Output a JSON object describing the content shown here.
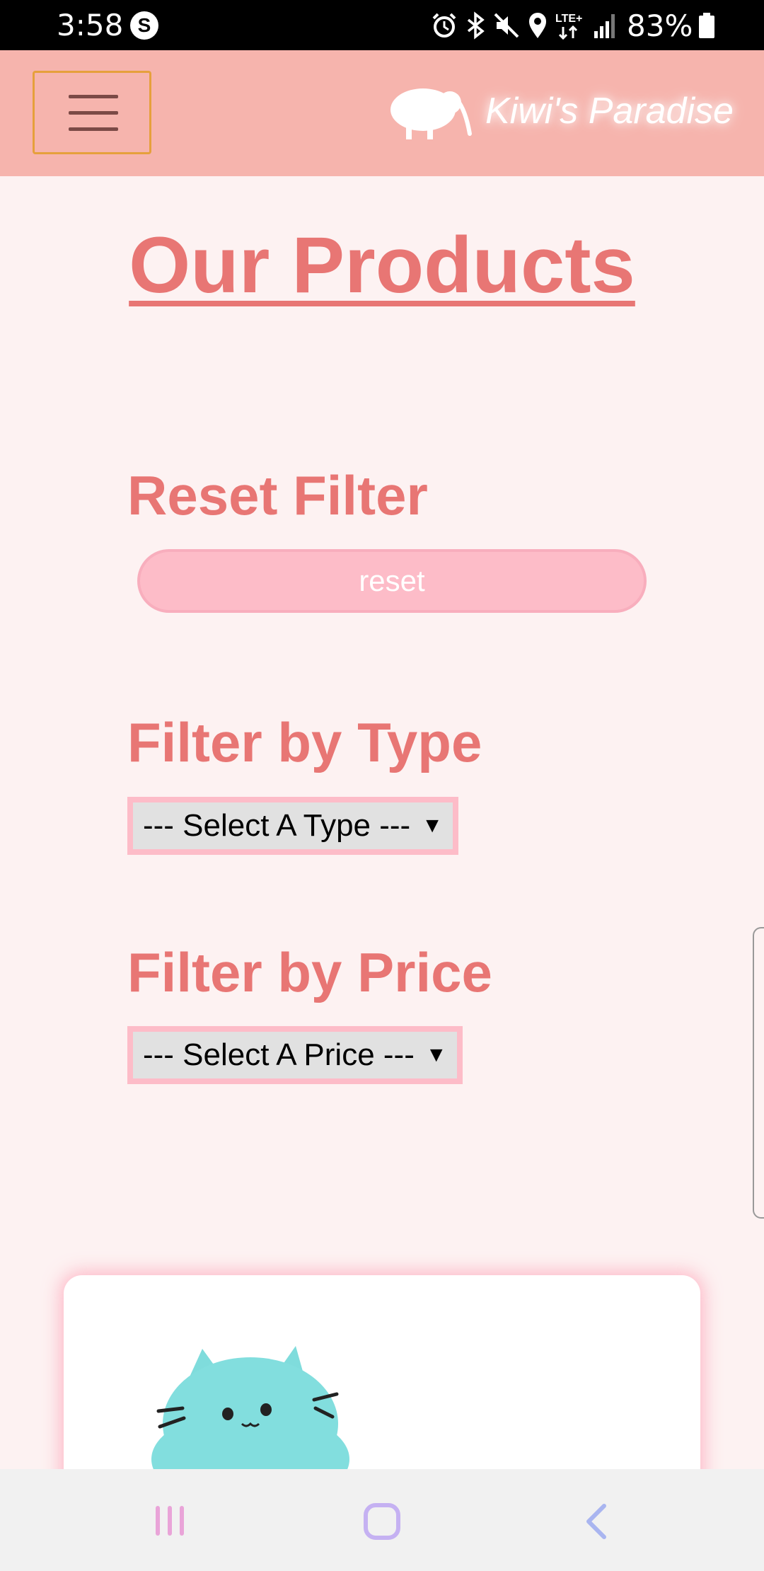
{
  "status_bar": {
    "time": "3:58",
    "s_icon": "S",
    "battery_percent": "83%",
    "icons": [
      "alarm-icon",
      "bluetooth-icon",
      "mute-icon",
      "location-icon",
      "lte-icon",
      "signal-icon",
      "battery-icon"
    ],
    "lte_label": "LTE+"
  },
  "header": {
    "brand_name": "Kiwi's Paradise",
    "background_color": "#f6b4ad"
  },
  "main": {
    "title": "Our Products",
    "reset_heading": "Reset Filter",
    "reset_button": "reset",
    "type_heading": "Filter by Type",
    "type_select": "--- Select A Type ---",
    "price_heading": "Filter by Price",
    "price_select": "--- Select A Price ---",
    "accent_color": "#e87674"
  },
  "nav_bar": {
    "icons": [
      "recent-apps-icon",
      "home-icon",
      "back-icon"
    ]
  }
}
